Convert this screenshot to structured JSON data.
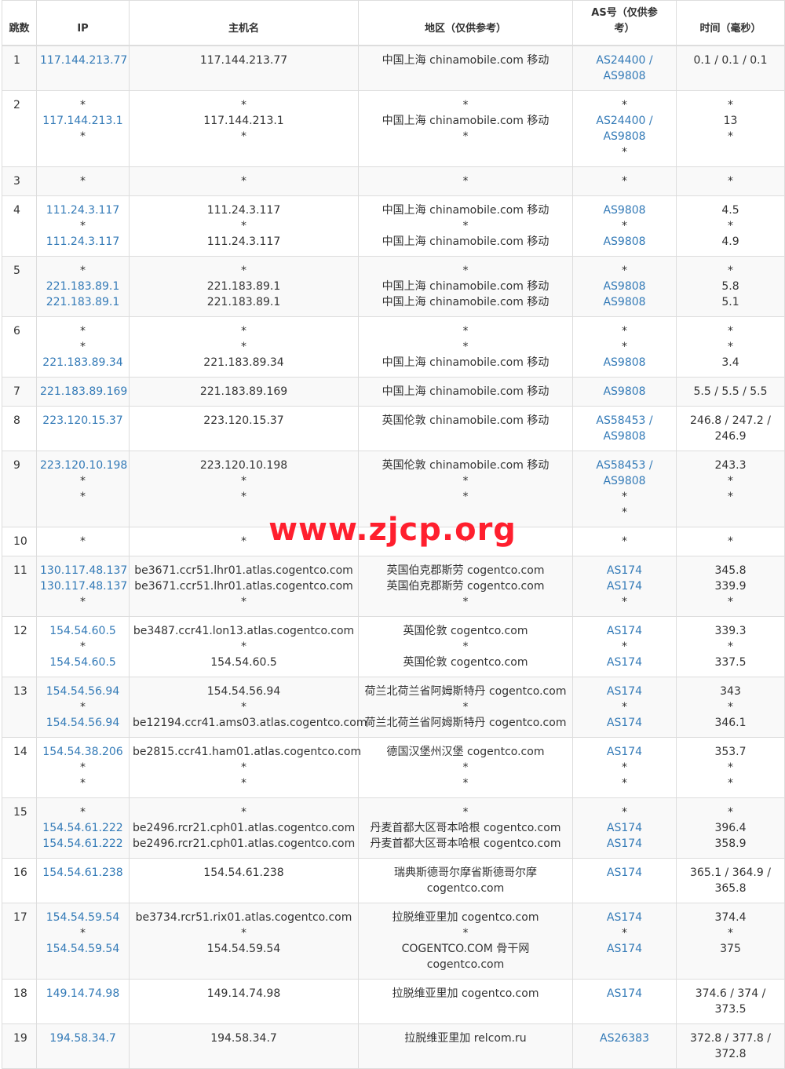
{
  "headers": {
    "hop": "跳数",
    "ip": "IP",
    "host": "主机名",
    "region": "地区（仅供参考）",
    "as": "AS号（仅供参考）",
    "time": "时间（毫秒）"
  },
  "watermark": "www.zjcp.org",
  "colors": {
    "link": "#337ab7",
    "watermark": "#ff1f2e",
    "stripe": "#f9f9f9",
    "border": "#dddddd"
  },
  "rows": [
    {
      "hop": "1",
      "ip": [
        "117.144.213.77"
      ],
      "host": [
        "117.144.213.77"
      ],
      "region": [
        "中国上海 chinamobile.com 移动"
      ],
      "as": [
        "AS24400 /",
        "AS9808"
      ],
      "time": [
        "0.1 / 0.1 / 0.1"
      ]
    },
    {
      "hop": "2",
      "ip": [
        "*",
        "117.144.213.1",
        "*"
      ],
      "host": [
        "*",
        "117.144.213.1",
        "*"
      ],
      "region": [
        "*",
        "中国上海 chinamobile.com 移动",
        "*"
      ],
      "as": [
        "*",
        "AS24400 /",
        "AS9808",
        "*"
      ],
      "time": [
        "*",
        "13",
        "*"
      ]
    },
    {
      "hop": "3",
      "ip": [
        "*"
      ],
      "host": [
        "*"
      ],
      "region": [
        "*"
      ],
      "as": [
        "*"
      ],
      "time": [
        "*"
      ]
    },
    {
      "hop": "4",
      "ip": [
        "111.24.3.117",
        "*",
        "111.24.3.117"
      ],
      "host": [
        "111.24.3.117",
        "*",
        "111.24.3.117"
      ],
      "region": [
        "中国上海 chinamobile.com 移动",
        "*",
        "中国上海 chinamobile.com 移动"
      ],
      "as": [
        "AS9808",
        "*",
        "AS9808"
      ],
      "time": [
        "4.5",
        "*",
        "4.9"
      ]
    },
    {
      "hop": "5",
      "ip": [
        "*",
        "221.183.89.1",
        "221.183.89.1"
      ],
      "host": [
        "*",
        "221.183.89.1",
        "221.183.89.1"
      ],
      "region": [
        "*",
        "中国上海 chinamobile.com 移动",
        "中国上海 chinamobile.com 移动"
      ],
      "as": [
        "*",
        "AS9808",
        "AS9808"
      ],
      "time": [
        "*",
        "5.8",
        "5.1"
      ]
    },
    {
      "hop": "6",
      "ip": [
        "*",
        "*",
        "221.183.89.34"
      ],
      "host": [
        "*",
        "*",
        "221.183.89.34"
      ],
      "region": [
        "*",
        "*",
        "中国上海 chinamobile.com 移动"
      ],
      "as": [
        "*",
        "*",
        "AS9808"
      ],
      "time": [
        "*",
        "*",
        "3.4"
      ]
    },
    {
      "hop": "7",
      "ip": [
        "221.183.89.169"
      ],
      "host": [
        "221.183.89.169"
      ],
      "region": [
        "中国上海 chinamobile.com 移动"
      ],
      "as": [
        "AS9808"
      ],
      "time": [
        "5.5 / 5.5 / 5.5"
      ]
    },
    {
      "hop": "8",
      "ip": [
        "223.120.15.37"
      ],
      "host": [
        "223.120.15.37"
      ],
      "region": [
        "英国伦敦 chinamobile.com 移动"
      ],
      "as": [
        "AS58453 /",
        "AS9808"
      ],
      "time": [
        "246.8 / 247.2 /",
        "246.9"
      ]
    },
    {
      "hop": "9",
      "ip": [
        "223.120.10.198",
        "*",
        "*"
      ],
      "host": [
        "223.120.10.198",
        "*",
        "*"
      ],
      "region": [
        "英国伦敦 chinamobile.com 移动",
        "*",
        "*"
      ],
      "as": [
        "AS58453 /",
        "AS9808",
        "*",
        "*"
      ],
      "time": [
        "243.3",
        "*",
        "*"
      ]
    },
    {
      "hop": "10",
      "ip": [
        "*"
      ],
      "host": [
        "*"
      ],
      "region": [
        "*"
      ],
      "as": [
        "*"
      ],
      "time": [
        "*"
      ]
    },
    {
      "hop": "11",
      "ip": [
        "130.117.48.137",
        "130.117.48.137",
        "*"
      ],
      "host": [
        "be3671.ccr51.lhr01.atlas.cogentco.com",
        "be3671.ccr51.lhr01.atlas.cogentco.com",
        "*"
      ],
      "region": [
        "英国伯克郡斯劳 cogentco.com",
        "英国伯克郡斯劳 cogentco.com",
        "*"
      ],
      "as": [
        "AS174",
        "AS174",
        "*"
      ],
      "time": [
        "345.8",
        "339.9",
        "*"
      ]
    },
    {
      "hop": "12",
      "ip": [
        "154.54.60.5",
        "*",
        "154.54.60.5"
      ],
      "host": [
        "be3487.ccr41.lon13.atlas.cogentco.com",
        "*",
        "154.54.60.5"
      ],
      "region": [
        "英国伦敦 cogentco.com",
        "*",
        "英国伦敦 cogentco.com"
      ],
      "as": [
        "AS174",
        "*",
        "AS174"
      ],
      "time": [
        "339.3",
        "*",
        "337.5"
      ]
    },
    {
      "hop": "13",
      "ip": [
        "154.54.56.94",
        "*",
        "154.54.56.94"
      ],
      "host": [
        "154.54.56.94",
        "*",
        "be12194.ccr41.ams03.atlas.cogentco.com"
      ],
      "region": [
        "荷兰北荷兰省阿姆斯特丹 cogentco.com",
        "*",
        "荷兰北荷兰省阿姆斯特丹 cogentco.com"
      ],
      "as": [
        "AS174",
        "*",
        "AS174"
      ],
      "time": [
        "343",
        "*",
        "346.1"
      ]
    },
    {
      "hop": "14",
      "ip": [
        "154.54.38.206",
        "*",
        "*"
      ],
      "host": [
        "be2815.ccr41.ham01.atlas.cogentco.com",
        "*",
        "*"
      ],
      "region": [
        "德国汉堡州汉堡 cogentco.com",
        "*",
        "*"
      ],
      "as": [
        "AS174",
        "*",
        "*"
      ],
      "time": [
        "353.7",
        "*",
        "*"
      ]
    },
    {
      "hop": "15",
      "ip": [
        "*",
        "154.54.61.222",
        "154.54.61.222"
      ],
      "host": [
        "*",
        "be2496.rcr21.cph01.atlas.cogentco.com",
        "be2496.rcr21.cph01.atlas.cogentco.com"
      ],
      "region": [
        "*",
        "丹麦首都大区哥本哈根 cogentco.com",
        "丹麦首都大区哥本哈根 cogentco.com"
      ],
      "as": [
        "*",
        "AS174",
        "AS174"
      ],
      "time": [
        "*",
        "396.4",
        "358.9"
      ]
    },
    {
      "hop": "16",
      "ip": [
        "154.54.61.238"
      ],
      "host": [
        "154.54.61.238"
      ],
      "region": [
        "瑞典斯德哥尔摩省斯德哥尔摩",
        "cogentco.com"
      ],
      "as": [
        "AS174"
      ],
      "time": [
        "365.1 / 364.9 /",
        "365.8"
      ]
    },
    {
      "hop": "17",
      "ip": [
        "154.54.59.54",
        "*",
        "154.54.59.54"
      ],
      "host": [
        "be3734.rcr51.rix01.atlas.cogentco.com",
        "*",
        "154.54.59.54"
      ],
      "region": [
        "拉脱维亚里加 cogentco.com",
        "*",
        "COGENTCO.COM 骨干网",
        "cogentco.com"
      ],
      "as": [
        "AS174",
        "*",
        "AS174"
      ],
      "time": [
        "374.4",
        "*",
        "375"
      ]
    },
    {
      "hop": "18",
      "ip": [
        "149.14.74.98"
      ],
      "host": [
        "149.14.74.98"
      ],
      "region": [
        "拉脱维亚里加 cogentco.com"
      ],
      "as": [
        "AS174"
      ],
      "time": [
        "374.6 / 374 /",
        "373.5"
      ]
    },
    {
      "hop": "19",
      "ip": [
        "194.58.34.7"
      ],
      "host": [
        "194.58.34.7"
      ],
      "region": [
        "拉脱维亚里加 relcom.ru"
      ],
      "as": [
        "AS26383"
      ],
      "time": [
        "372.8 / 377.8 /",
        "372.8"
      ]
    }
  ]
}
